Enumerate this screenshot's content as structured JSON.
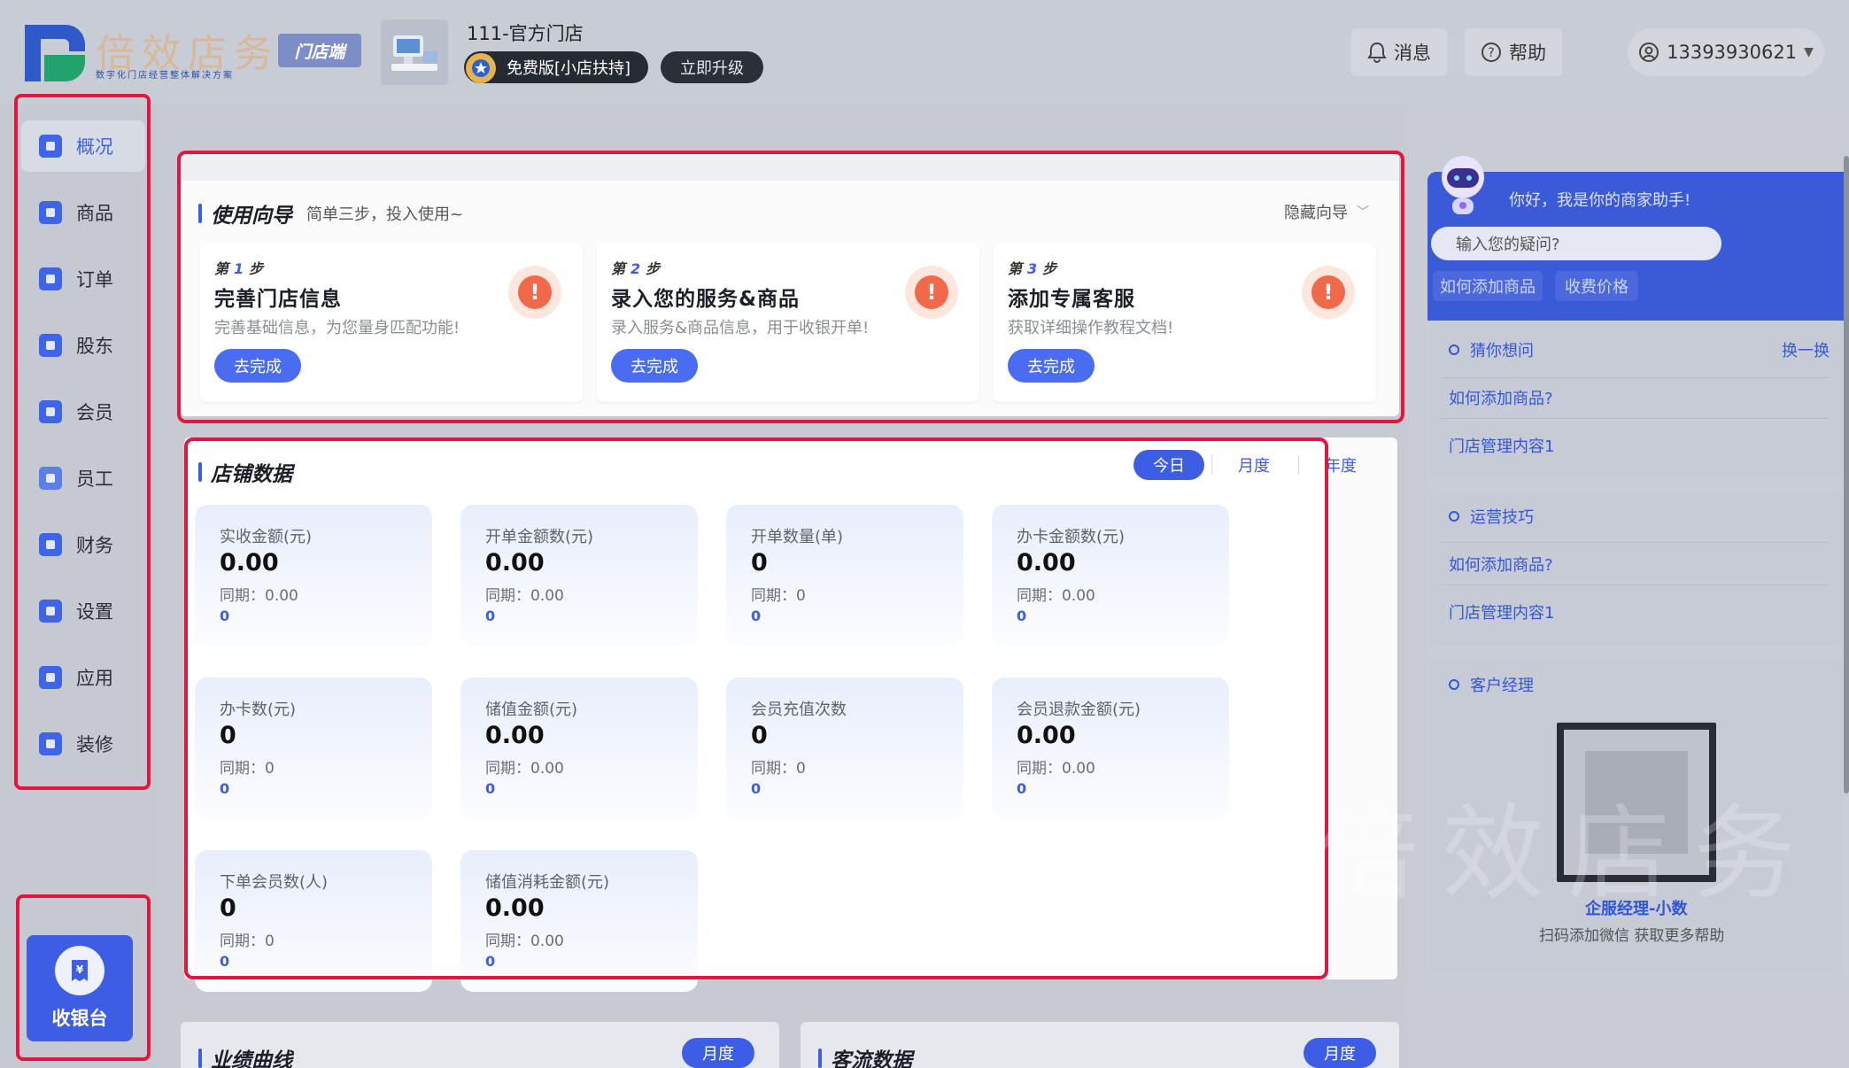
{
  "brand": {
    "name": "倍效店务",
    "tagline": "数字化门店经营整体解决方案",
    "terminal_tag": "门店端"
  },
  "header": {
    "store_name": "111-官方门店",
    "plan_label": "免费版[小店扶持]",
    "upgrade_label": "立即升级",
    "messages_label": "消息",
    "help_label": "帮助",
    "user_phone": "13393930621"
  },
  "sidebar": {
    "items": [
      {
        "label": "概况",
        "icon": "overview-icon",
        "color": "#3f64e8"
      },
      {
        "label": "商品",
        "icon": "goods-icon",
        "color": "#3f64e8"
      },
      {
        "label": "订单",
        "icon": "order-icon",
        "color": "#3f64e8"
      },
      {
        "label": "股东",
        "icon": "shareholder-icon",
        "color": "#3f64e8"
      },
      {
        "label": "会员",
        "icon": "member-icon",
        "color": "#3f64e8"
      },
      {
        "label": "员工",
        "icon": "staff-icon",
        "color": "#3f64e8"
      },
      {
        "label": "财务",
        "icon": "finance-icon",
        "color": "#3f64e8"
      },
      {
        "label": "设置",
        "icon": "settings-icon",
        "color": "#3f64e8"
      },
      {
        "label": "应用",
        "icon": "apps-icon",
        "color": "#3f64e8"
      },
      {
        "label": "装修",
        "icon": "decor-icon",
        "color": "#3f64e8"
      }
    ],
    "active_index": 0,
    "cashier_label": "收银台"
  },
  "guide": {
    "title": "使用向导",
    "subtitle": "简单三步，投入使用~",
    "hide_label": "隐藏向导",
    "steps": [
      {
        "prefix": "第",
        "num": "1",
        "suffix": "步",
        "title": "完善门店信息",
        "desc": "完善基础信息，为您量身匹配功能!",
        "button": "去完成"
      },
      {
        "prefix": "第",
        "num": "2",
        "suffix": "步",
        "title": "录入您的服务&商品",
        "desc": "录入服务&商品信息，用于收银开单!",
        "button": "去完成"
      },
      {
        "prefix": "第",
        "num": "3",
        "suffix": "步",
        "title": "添加专属客服",
        "desc": "获取详细操作教程文档!",
        "button": "去完成"
      }
    ]
  },
  "store_data": {
    "title": "店铺数据",
    "tabs": [
      "今日",
      "月度",
      "年度"
    ],
    "active_tab": 0,
    "stats": [
      {
        "label": "实收金额(元)",
        "value": "0.00",
        "compare": "同期：0.00",
        "count": "0"
      },
      {
        "label": "开单金额数(元)",
        "value": "0.00",
        "compare": "同期：0.00",
        "count": "0"
      },
      {
        "label": "开单数量(单)",
        "value": "0",
        "compare": "同期：0",
        "count": "0"
      },
      {
        "label": "办卡金额数(元)",
        "value": "0.00",
        "compare": "同期：0.00",
        "count": "0"
      },
      {
        "label": "办卡数(元)",
        "value": "0",
        "compare": "同期：0",
        "count": "0"
      },
      {
        "label": "储值金额(元)",
        "value": "0.00",
        "compare": "同期：0.00",
        "count": "0"
      },
      {
        "label": "会员充值次数",
        "value": "0",
        "compare": "同期：0",
        "count": "0"
      },
      {
        "label": "会员退款金额(元)",
        "value": "0.00",
        "compare": "同期：0.00",
        "count": "0"
      },
      {
        "label": "下单会员数(人)",
        "value": "0",
        "compare": "同期：0",
        "count": "0"
      },
      {
        "label": "储值消耗金额(元)",
        "value": "0.00",
        "compare": "同期：0.00",
        "count": "0"
      }
    ]
  },
  "performance": {
    "title": "业绩曲线",
    "tab": "月度"
  },
  "traffic": {
    "title": "客流数据",
    "tab": "月度"
  },
  "assistant": {
    "greeting": "你好，我是你的商家助手!",
    "search_placeholder": "输入您的疑问?",
    "chips": [
      "如何添加商品",
      "收费价格"
    ],
    "guess": {
      "title": "猜你想问",
      "refresh": "换一换",
      "items": [
        "如何添加商品?",
        "门店管理内容1"
      ]
    },
    "tips": {
      "title": "运营技巧",
      "items": [
        "如何添加商品?",
        "门店管理内容1"
      ]
    },
    "manager": {
      "title": "客户经理",
      "name": "企服经理-小数",
      "desc": "扫码添加微信 获取更多帮助"
    }
  },
  "colors": {
    "accent": "#3c5de4",
    "highlight_box": "#e0173f",
    "warning": "#f0694a"
  }
}
